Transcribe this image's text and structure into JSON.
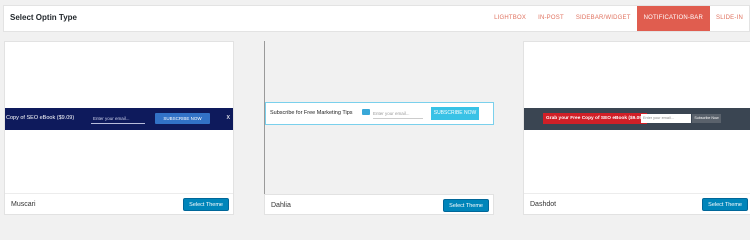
{
  "header": {
    "title": "Select Optin Type",
    "tabs": [
      "LIGHTBOX",
      "IN-POST",
      "SIDEBAR/WIDGET",
      "NOTIFICATION-BAR",
      "SLIDE-IN"
    ],
    "active_tab": "NOTIFICATION-BAR"
  },
  "themes": [
    {
      "name": "Muscari",
      "select_label": "Select Theme",
      "bar_text": "Copy of SEO eBook ($9.09)",
      "input_placeholder": "Enter your email...",
      "button_label": "SUBSCRIBE NOW",
      "close": "x"
    },
    {
      "name": "Dahlia",
      "select_label": "Select Theme",
      "bar_text": "Subscribe for Free Marketing Tips",
      "input_placeholder": "Enter your email...",
      "button_label": "SUBSCRIBE NOW"
    },
    {
      "name": "Dashdot",
      "select_label": "Select Theme",
      "bar_text": "Grab your Free Copy of SEO eBook ($9.09)",
      "input_placeholder": "Enter your email...",
      "button_label": "Subscribe Now"
    }
  ],
  "colors": {
    "accent": "#e05d4f",
    "select_button": "#0085ba",
    "muscari_bar": "#0e1a5c",
    "dahlia_button": "#39c2e6",
    "dashdot_bar": "#3a4552",
    "dashdot_label": "#d01f27"
  }
}
